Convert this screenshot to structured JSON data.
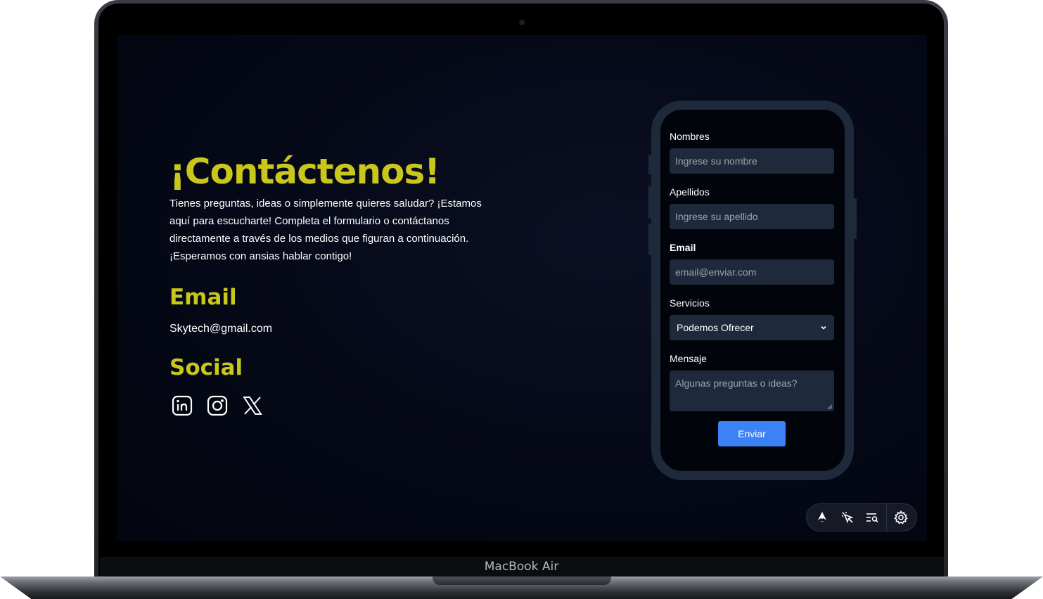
{
  "device": {
    "model_label": "MacBook Air"
  },
  "contact": {
    "title": "¡Contáctenos!",
    "intro": "Tienes preguntas, ideas o simplemente quieres saludar? ¡Estamos aquí para escucharte! Completa el formulario o contáctanos directamente a través de los medios que figuran a continuación. ¡Esperamos con ansias hablar contigo!",
    "email_heading": "Email",
    "email_value": "Skytech@gmail.com",
    "social_heading": "Social",
    "social_icons": [
      "linkedin-icon",
      "instagram-icon",
      "x-icon"
    ]
  },
  "form": {
    "nombres_label": "Nombres",
    "nombres_placeholder": "Ingrese su nombre",
    "apellidos_label": "Apellidos",
    "apellidos_placeholder": "Ingrese su apellido",
    "email_label": "Email",
    "email_placeholder": "email@enviar.com",
    "servicios_label": "Servicios",
    "servicios_selected": "Podemos Ofrecer",
    "mensaje_label": "Mensaje",
    "mensaje_placeholder": "Algunas preguntas o ideas?",
    "submit_label": "Enviar"
  },
  "toolbar": {
    "icons": [
      "astro-logo-icon",
      "inspect-cursor-icon",
      "audit-list-icon",
      "settings-gear-icon"
    ]
  },
  "colors": {
    "accent_yellow": "#c9c61c",
    "button_blue": "#3b82f6",
    "field_bg": "#1e293b",
    "screen_bg": "#050816"
  }
}
